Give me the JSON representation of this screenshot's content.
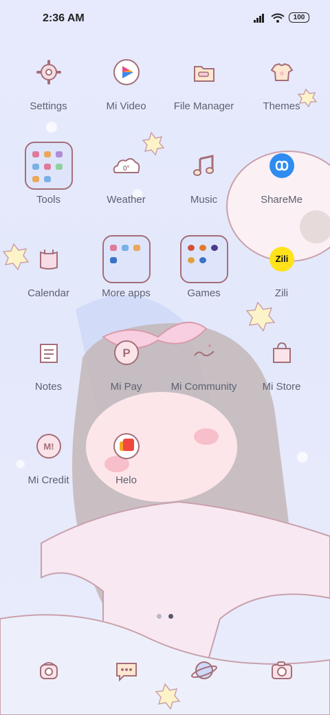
{
  "status_bar": {
    "time": "2:36 AM",
    "battery": "100",
    "icons": [
      "signal-icon",
      "wifi-icon",
      "battery-icon"
    ]
  },
  "apps": [
    {
      "label": "Settings",
      "icon": "gear-icon"
    },
    {
      "label": "Mi Video",
      "icon": "play-icon"
    },
    {
      "label": "File Manager",
      "icon": "folder-icon"
    },
    {
      "label": "Themes",
      "icon": "shirt-icon"
    },
    {
      "label": "Tools",
      "icon": "folder-icon"
    },
    {
      "label": "Weather",
      "icon": "weather-cloud-icon",
      "badge": "0°"
    },
    {
      "label": "Music",
      "icon": "music-note-icon"
    },
    {
      "label": "ShareMe",
      "icon": "shareme-icon"
    },
    {
      "label": "Calendar",
      "icon": "calendar-icon"
    },
    {
      "label": "More apps",
      "icon": "folder-icon"
    },
    {
      "label": "Games",
      "icon": "folder-icon"
    },
    {
      "label": "Zili",
      "icon": "zili-icon",
      "badge": "Zili"
    },
    {
      "label": "Notes",
      "icon": "notes-icon"
    },
    {
      "label": "Mi Pay",
      "icon": "pay-icon",
      "badge": "P"
    },
    {
      "label": "Mi Community",
      "icon": "community-icon"
    },
    {
      "label": "Mi Store",
      "icon": "shopping-bag-icon"
    },
    {
      "label": "Mi Credit",
      "icon": "credit-icon",
      "badge": "M!"
    },
    {
      "label": "Helo",
      "icon": "helo-icon"
    }
  ],
  "dock": [
    {
      "icon": "phone-icon"
    },
    {
      "icon": "messages-icon"
    },
    {
      "icon": "browser-planet-icon"
    },
    {
      "icon": "camera-icon"
    }
  ],
  "page_indicator": {
    "count": 2,
    "active": 2
  },
  "colors": {
    "icon_stroke": "#a46e78",
    "label": "#5d6070",
    "accent_blue": "#2f8cf0"
  }
}
